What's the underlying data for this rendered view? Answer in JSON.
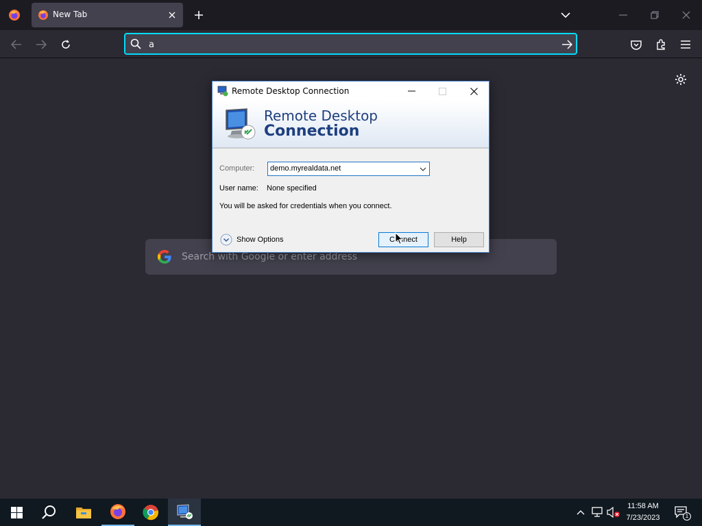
{
  "browser": {
    "tab": {
      "title": "New Tab"
    },
    "urlbar": {
      "value": "a"
    }
  },
  "newtab": {
    "search_placeholder": "Search with Google or enter address"
  },
  "rdc": {
    "title": "Remote Desktop Connection",
    "banner_line1": "Remote Desktop",
    "banner_line2": "Connection",
    "computer_label": "Computer:",
    "computer_value": "demo.myrealdata.net",
    "username_label": "User name:",
    "username_value": "None specified",
    "credentials_note": "You will be asked for credentials when you connect.",
    "show_options": "Show Options",
    "connect_label": "Connect",
    "help_label": "Help"
  },
  "taskbar": {
    "time": "11:58 AM",
    "date": "7/23/2023",
    "notification_count": "1"
  },
  "colors": {
    "browser_bg": "#2b2a33",
    "tabstrip_bg": "#1c1b22",
    "urlbar_focus": "#00ddff",
    "taskbar_bg": "#101820",
    "rdc_accent": "#1f3f7f"
  }
}
